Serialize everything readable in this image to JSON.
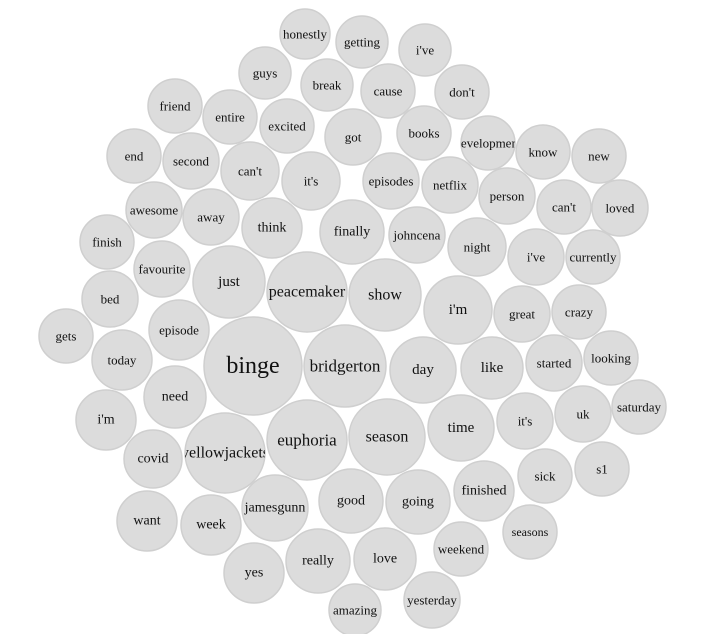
{
  "chart_data": {
    "type": "bubble",
    "words": [
      "honestly",
      "getting",
      "i've",
      "guys",
      "break",
      "cause",
      "don't",
      "friend",
      "entire",
      "excited",
      "got",
      "books",
      "development",
      "know",
      "new",
      "end",
      "second",
      "can't",
      "it's",
      "episodes",
      "netflix",
      "person",
      "can't",
      "loved",
      "awesome",
      "away",
      "think",
      "finally",
      "johncena",
      "night",
      "i've",
      "currently",
      "finish",
      "favourite",
      "just",
      "peacemaker",
      "show",
      "i'm",
      "great",
      "crazy",
      "bed",
      "episode",
      "gets",
      "today",
      "binge",
      "bridgerton",
      "day",
      "like",
      "started",
      "looking",
      "need",
      "i'm",
      "uk",
      "saturday",
      "it's",
      "time",
      "season",
      "euphoria",
      "yellowjackets",
      "covid",
      "sick",
      "s1",
      "finished",
      "going",
      "good",
      "jamesgunn",
      "want",
      "week",
      "seasons",
      "weekend",
      "love",
      "really",
      "yes",
      "yesterday",
      "amazing"
    ]
  }
}
